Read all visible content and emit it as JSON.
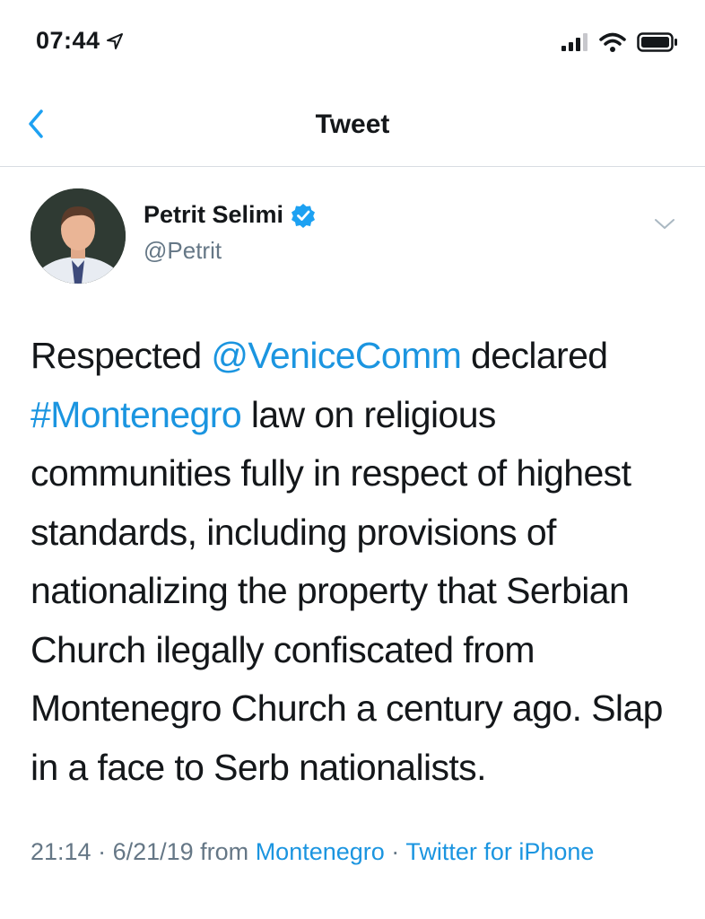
{
  "status_bar": {
    "time": "07:44"
  },
  "nav": {
    "title": "Tweet"
  },
  "author": {
    "display_name": "Petrit Selimi",
    "handle": "@Petrit"
  },
  "tweet": {
    "text_1": "Respected ",
    "mention": "@VeniceComm",
    "text_2": " declared ",
    "hashtag": "#Montenegro",
    "text_3": " law on religious communities fully in respect of highest standards, including provisions of nationalizing the property that Serbian Church ilegally confiscated from Montenegro Church a century ago. Slap in a face to Serb nationalists."
  },
  "meta": {
    "time": "21:14",
    "separator_1": " · ",
    "date": "6/21/19",
    "from_label": " from ",
    "location": "Montenegro",
    "separator_2": " · ",
    "source": "Twitter for iPhone"
  },
  "colors": {
    "link": "#1b95e0",
    "secondary_text": "#657786",
    "verified": "#1da1f2"
  }
}
